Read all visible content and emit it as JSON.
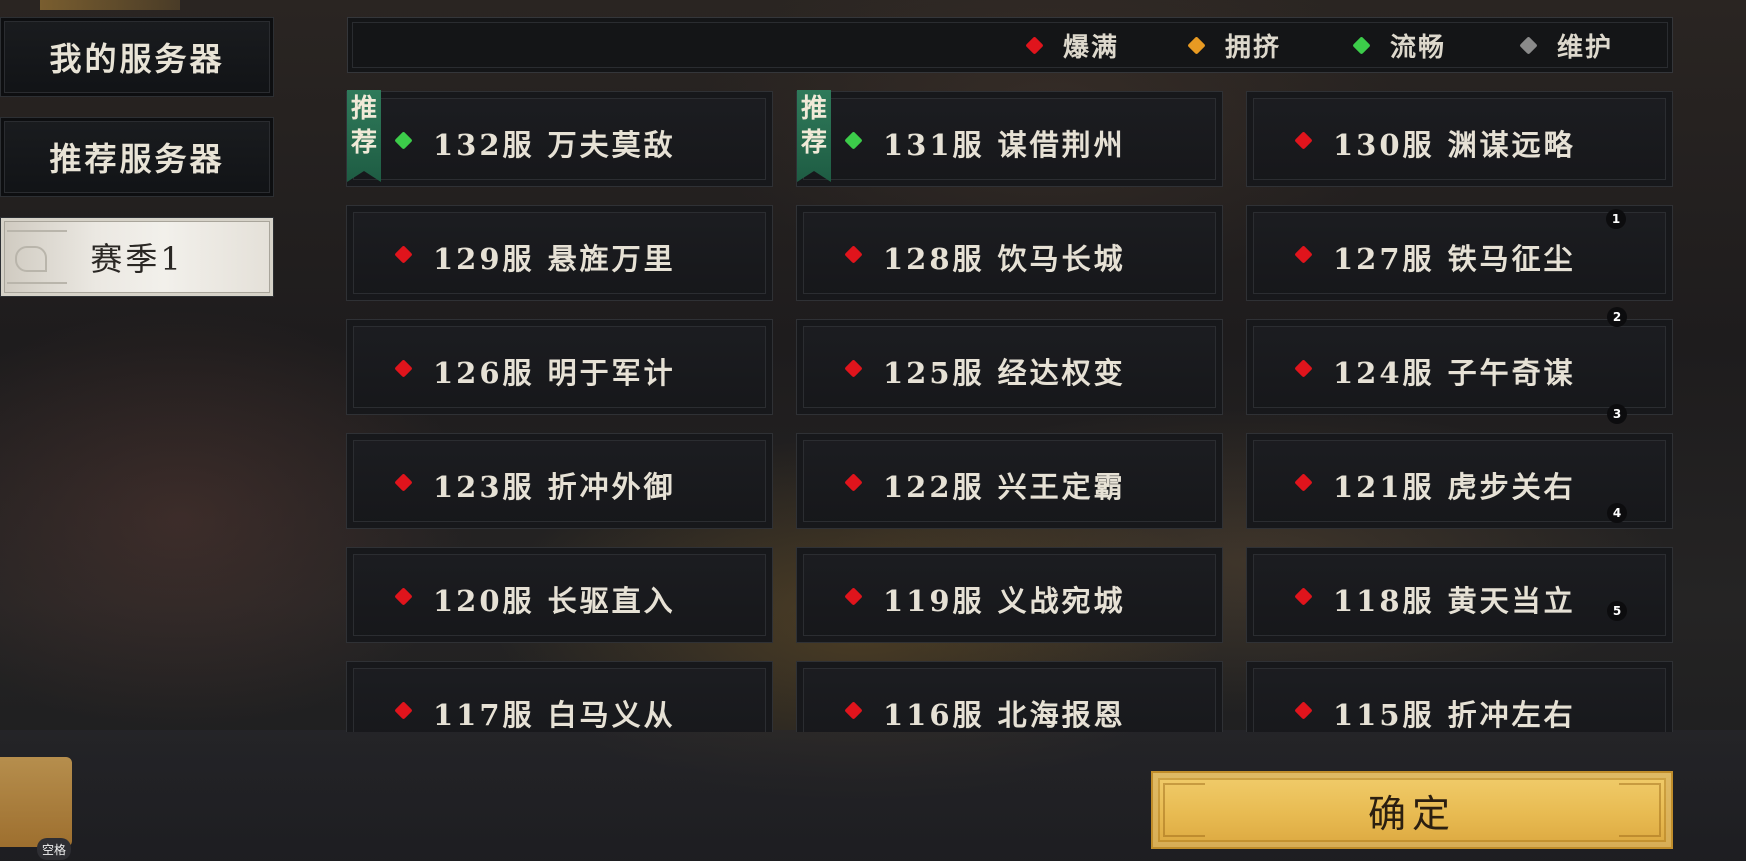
{
  "sidebar": {
    "items": [
      {
        "label": "我的服务器",
        "active": false
      },
      {
        "label": "推荐服务器",
        "active": false
      },
      {
        "label": "赛季1",
        "active": true
      }
    ]
  },
  "legend": {
    "items": [
      {
        "label": "爆满",
        "color": "#e0141c"
      },
      {
        "label": "拥挤",
        "color": "#e89a22"
      },
      {
        "label": "流畅",
        "color": "#3ccc4a"
      },
      {
        "label": "维护",
        "color": "#8a8a8a"
      }
    ]
  },
  "servers": [
    {
      "name": "132服  万夫莫敌",
      "status": "流畅",
      "status_color": "#3ccc4a",
      "recommended": true
    },
    {
      "name": "131服  谋借荆州",
      "status": "流畅",
      "status_color": "#3ccc4a",
      "recommended": true
    },
    {
      "name": "130服  渊谋远略",
      "status": "爆满",
      "status_color": "#e0141c",
      "recommended": false
    },
    {
      "name": "129服  悬旌万里",
      "status": "爆满",
      "status_color": "#e0141c",
      "recommended": false
    },
    {
      "name": "128服  饮马长城",
      "status": "爆满",
      "status_color": "#e0141c",
      "recommended": false
    },
    {
      "name": "127服  铁马征尘",
      "status": "爆满",
      "status_color": "#e0141c",
      "recommended": false
    },
    {
      "name": "126服  明于军计",
      "status": "爆满",
      "status_color": "#e0141c",
      "recommended": false
    },
    {
      "name": "125服  经达权变",
      "status": "爆满",
      "status_color": "#e0141c",
      "recommended": false
    },
    {
      "name": "124服  子午奇谋",
      "status": "爆满",
      "status_color": "#e0141c",
      "recommended": false
    },
    {
      "name": "123服  折冲外御",
      "status": "爆满",
      "status_color": "#e0141c",
      "recommended": false
    },
    {
      "name": "122服  兴王定霸",
      "status": "爆满",
      "status_color": "#e0141c",
      "recommended": false
    },
    {
      "name": "121服  虎步关右",
      "status": "爆满",
      "status_color": "#e0141c",
      "recommended": false
    },
    {
      "name": "120服  长驱直入",
      "status": "爆满",
      "status_color": "#e0141c",
      "recommended": false
    },
    {
      "name": "119服  义战宛城",
      "status": "爆满",
      "status_color": "#e0141c",
      "recommended": false
    },
    {
      "name": "118服  黄天当立",
      "status": "爆满",
      "status_color": "#e0141c",
      "recommended": false
    },
    {
      "name": "117服  白马义从",
      "status": "爆满",
      "status_color": "#e0141c",
      "recommended": false
    },
    {
      "name": "116服  北海报恩",
      "status": "爆满",
      "status_color": "#e0141c",
      "recommended": false
    },
    {
      "name": "115服  折冲左右",
      "status": "爆满",
      "status_color": "#e0141c",
      "recommended": false
    }
  ],
  "recommend_tag": {
    "line1": "推",
    "line2": "荐"
  },
  "scroll_markers": [
    "1",
    "2",
    "3",
    "4",
    "5"
  ],
  "confirm_label": "确定",
  "space_hint": "空格"
}
